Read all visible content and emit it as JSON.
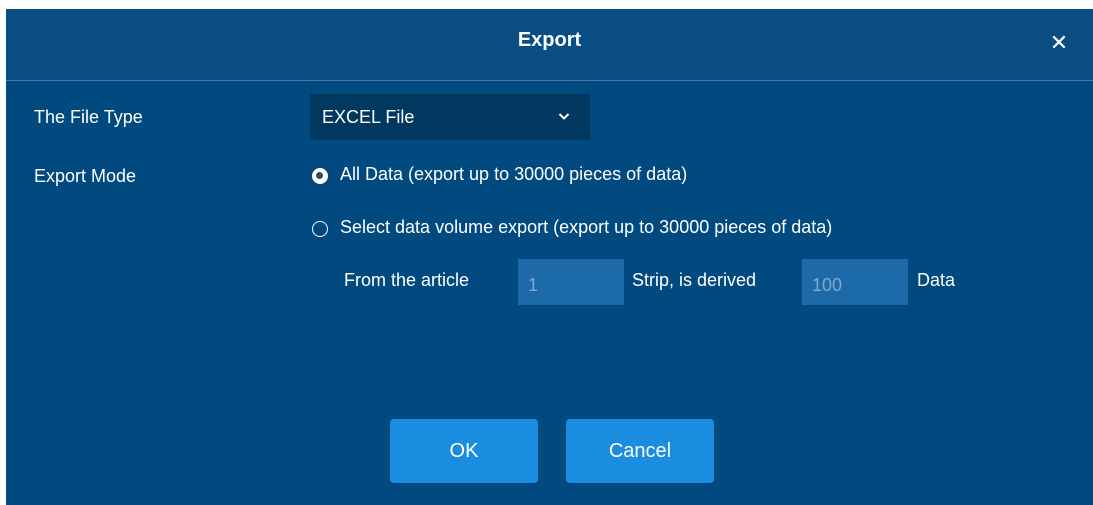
{
  "dialog": {
    "title": "Export",
    "close_icon": "close-icon"
  },
  "form": {
    "file_type_label": "The File Type",
    "file_type_value": "EXCEL File",
    "export_mode_label": "Export Mode",
    "modes": [
      {
        "label": "All Data (export up to 30000 pieces of data)",
        "checked": true
      },
      {
        "label": "Select data volume export (export up to 30000 pieces of data)",
        "checked": false
      }
    ],
    "range": {
      "from_label": "From the article",
      "from_value": "1",
      "middle_label": "Strip, is derived",
      "to_value": "100",
      "end_label": "Data"
    }
  },
  "buttons": {
    "ok": "OK",
    "cancel": "Cancel"
  },
  "colors": {
    "background": "#004a80",
    "select_bg": "#00385f",
    "input_bg": "#1d6aa8",
    "button_bg": "#1a8de0"
  }
}
